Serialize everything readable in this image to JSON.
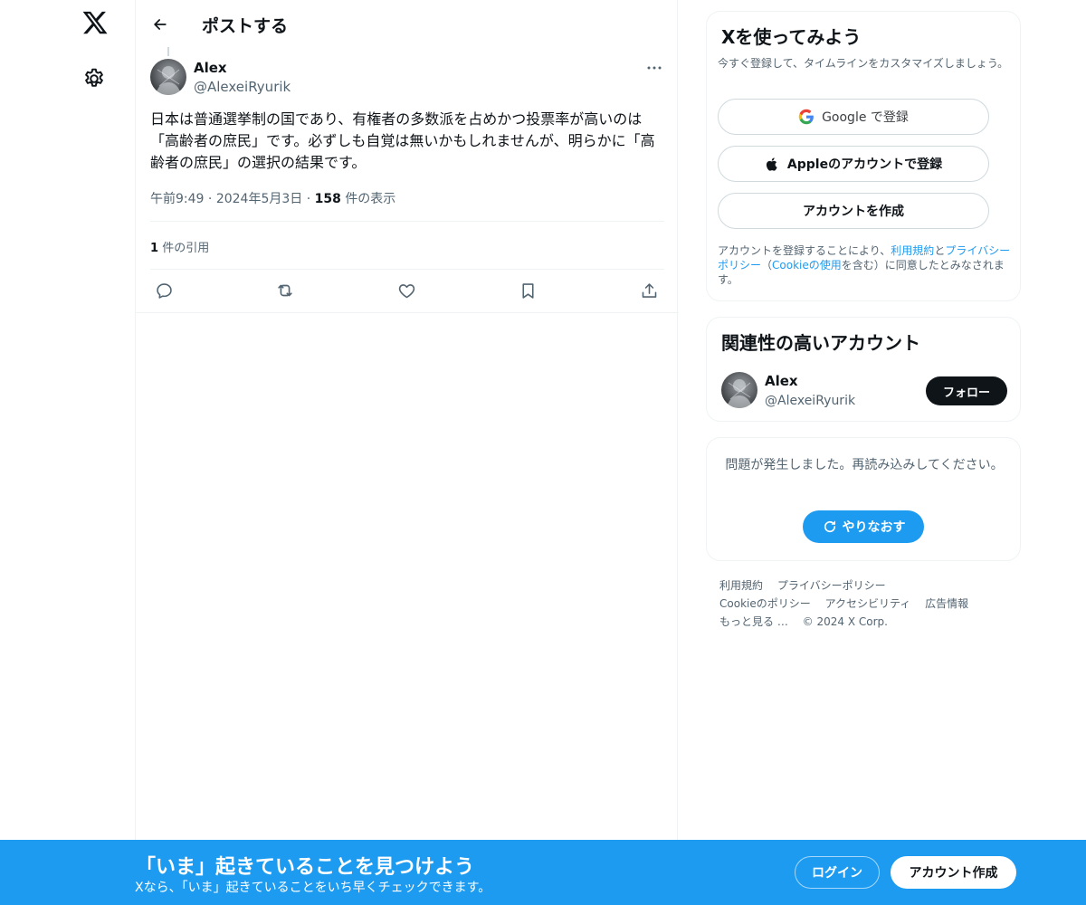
{
  "header": {
    "title": "ポストする"
  },
  "tweet": {
    "author_name": "Alex",
    "author_handle": "@AlexeiRyurik",
    "text": "日本は普通選挙制の国であり、有権者の多数派を占めかつ投票率が高いのは「高齢者の庶民」です。必ずしも自覚は無いかもしれませんが、明らかに「高齢者の庶民」の選択の結果です。",
    "time": "午前9:49",
    "date": "2024年5月3日",
    "views_count": "158",
    "views_label": "件の表示",
    "quotes_count": "1",
    "quotes_label": "件の引用"
  },
  "signup_card": {
    "title": "Xを使ってみよう",
    "subtitle": "今すぐ登録して、タイムラインをカスタマイズしましょう。",
    "google_label": "Google で登録",
    "apple_label": "Appleのアカウントで登録",
    "create_label": "アカウントを作成",
    "terms_prefix": "アカウントを登録することにより、",
    "terms_link": "利用規約",
    "terms_and": "と",
    "privacy_link": "プライバシーポリシー",
    "paren_open": "（",
    "cookie_link": "Cookieの使用",
    "terms_suffix": "を含む）に同意したとみなされます。"
  },
  "related_card": {
    "title": "関連性の高いアカウント",
    "name": "Alex",
    "handle": "@AlexeiRyurik",
    "follow_label": "フォロー"
  },
  "error_card": {
    "message": "問題が発生しました。再読み込みしてください。",
    "retry_label": "やりなおす"
  },
  "footer": {
    "terms": "利用規約",
    "privacy": "プライバシーポリシー",
    "cookie": "Cookieのポリシー",
    "accessibility": "アクセシビリティ",
    "ads": "広告情報",
    "more": "もっと見る …",
    "copyright": "© 2024 X Corp."
  },
  "banner": {
    "title": "「いま」起きていることを見つけよう",
    "subtitle": "Xなら、「いま」起きていることをいち早くチェックできます。",
    "login_label": "ログイン",
    "signup_label": "アカウント作成"
  },
  "colors": {
    "accent": "#1d9bf0",
    "text": "#0f1419",
    "muted": "#536471",
    "border": "#eff3f4"
  }
}
